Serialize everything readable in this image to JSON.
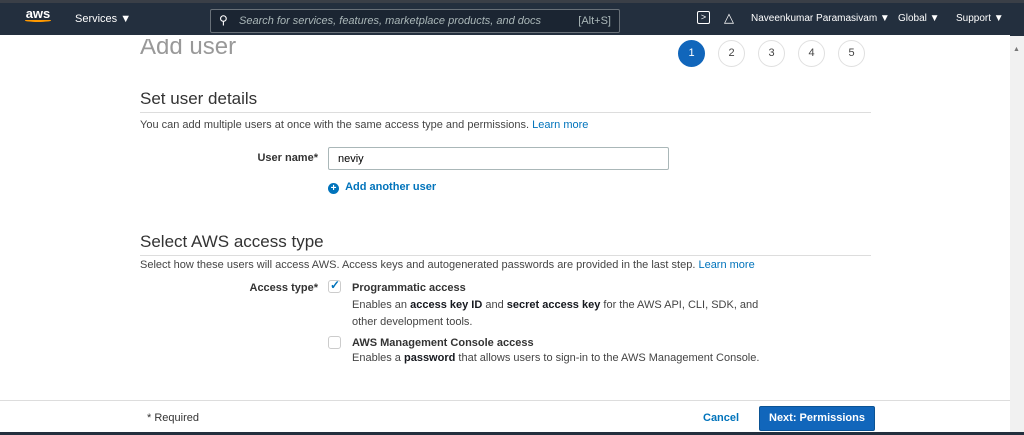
{
  "nav": {
    "logo": "aws",
    "services": "Services ▼",
    "search_placeholder": "Search for services, features, marketplace products, and docs",
    "search_shortcut": "[Alt+S]",
    "user": "Naveenkumar Paramasivam ▼",
    "region": "Global ▼",
    "support": "Support ▼"
  },
  "page": {
    "title": "Add user",
    "steps": [
      "1",
      "2",
      "3",
      "4",
      "5"
    ],
    "active_step": 1
  },
  "details": {
    "heading": "Set user details",
    "desc": "You can add multiple users at once with the same access type and permissions.",
    "learn_more": "Learn more",
    "username_label": "User name*",
    "username_value": "neviy",
    "add_another": "Add another user"
  },
  "access": {
    "heading": "Select AWS access type",
    "desc": "Select how these users will access AWS. Access keys and autogenerated passwords are provided in the last step.",
    "learn_more": "Learn more",
    "label": "Access type*",
    "programmatic": {
      "title": "Programmatic access",
      "checked": true,
      "d1": "Enables an ",
      "b1": "access key ID",
      "d2": " and ",
      "b2": "secret access key",
      "d3": " for the AWS API, CLI, SDK, and",
      "d4": "other development tools."
    },
    "console": {
      "title": "AWS Management Console access",
      "checked": false,
      "d1": "Enables a ",
      "b1": "password",
      "d2": " that allows users to sign-in to the AWS Management Console."
    }
  },
  "footer": {
    "required": "* Required",
    "cancel": "Cancel",
    "next": "Next: Permissions"
  }
}
